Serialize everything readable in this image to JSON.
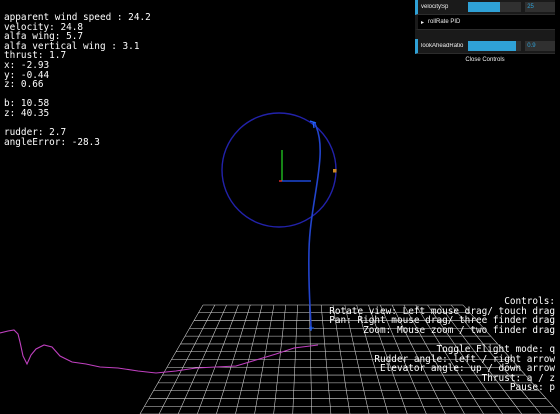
{
  "hud_left": [
    "apparent wind speed : 24.2",
    "velocity: 24.8",
    "alfa wing: 5.7",
    "alfa vertical wing : 3.1",
    "thrust: 1.7",
    "x: -2.93",
    "y: -0.44",
    "z: 0.66",
    "",
    "b: 10.58",
    "z: 40.35",
    "",
    "rudder: 2.7",
    "angleError: -28.3"
  ],
  "hud_right": [
    "Controls:",
    "Rotate view: Left mouse drag/ touch drag",
    "Pan: Right mouse drag/ three finder drag",
    "Zoom: Mouse zoom / two finder drag",
    "",
    "Toggle Flight mode: q",
    "Rudder angle: left / right arrow",
    "Elevator angle: up / down arrow",
    "Thrust: a / z",
    "Pause: p"
  ],
  "gui": {
    "velocity_label": "velocitySp",
    "velocity_value": "25",
    "velocity_fraction": 0.6,
    "folder_label": "rollRate PID",
    "lookahead_label": "lookAheadRatio",
    "lookahead_value": "0.9",
    "lookahead_fraction": 0.9,
    "close_label": "Close Controls",
    "accent_color": "#2fa1d6"
  },
  "colors": {
    "background": "#000000",
    "grid": "#ffffff",
    "target_circle": "#2222aa",
    "flight_path": "#2244cc",
    "trail": "#c040c0",
    "axis_y": "#22cc22",
    "axis_x": "#2255ff"
  }
}
